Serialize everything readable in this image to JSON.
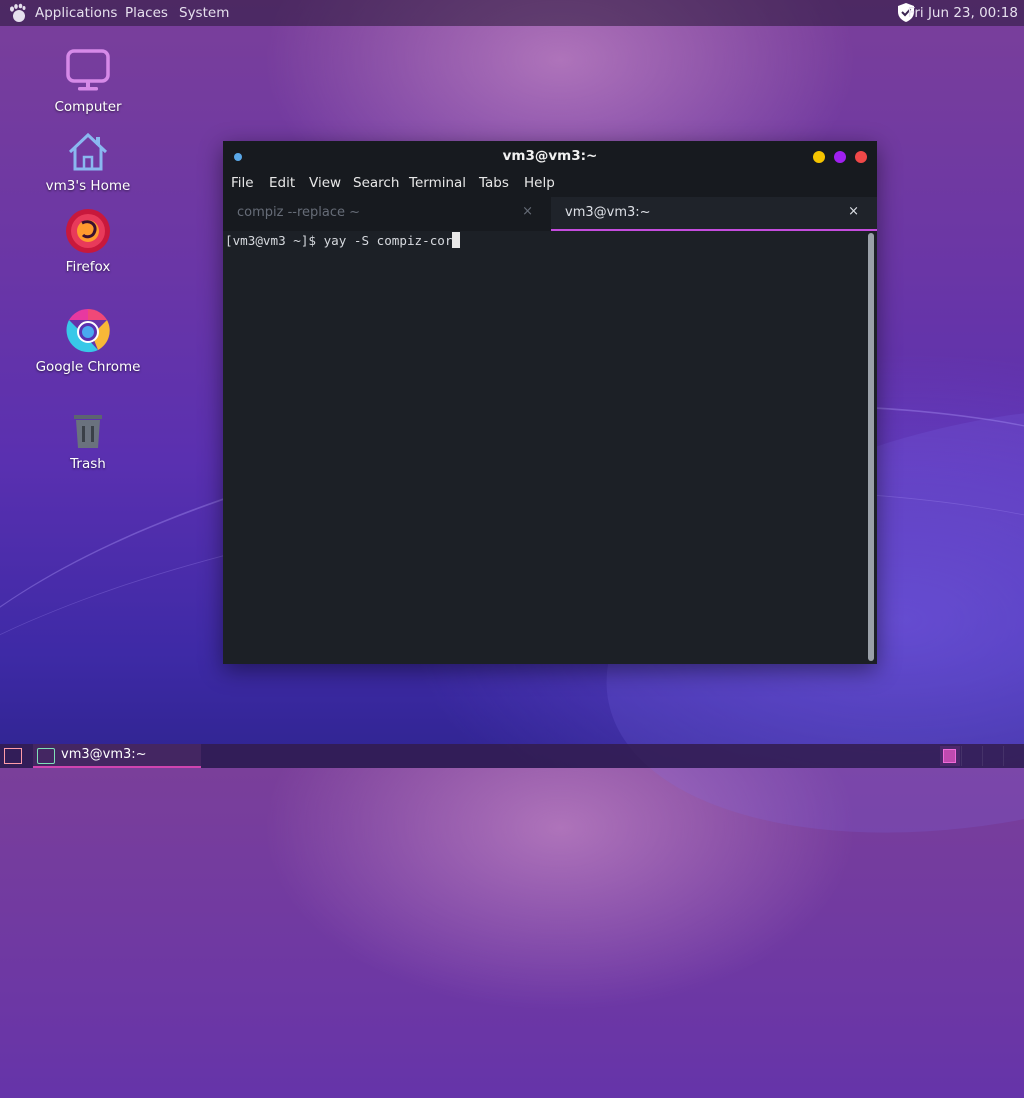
{
  "top_panel": {
    "menus": [
      "Applications",
      "Places",
      "System"
    ],
    "clock": "Fri Jun 23, 00:18"
  },
  "desktop_icons": [
    {
      "label": "Computer",
      "icon": "computer-icon"
    },
    {
      "label": "vm3's Home",
      "icon": "home-folder-icon"
    },
    {
      "label": "Firefox",
      "icon": "firefox-icon"
    },
    {
      "label": "Google Chrome",
      "icon": "chrome-icon"
    },
    {
      "label": "Trash",
      "icon": "trash-icon"
    }
  ],
  "terminal": {
    "title": "vm3@vm3:~",
    "menu": [
      "File",
      "Edit",
      "View",
      "Search",
      "Terminal",
      "Tabs",
      "Help"
    ],
    "tabs": [
      {
        "label": "compiz --replace ~",
        "close": "×",
        "active": false
      },
      {
        "label": "vm3@vm3:~",
        "close": "×",
        "active": true
      }
    ],
    "prompt": "[vm3@vm3 ~]$ yay -S compiz-cor",
    "window_button_colors": [
      "#f5c400",
      "#a020f0",
      "#f04848"
    ]
  },
  "taskbar": {
    "task_label": "vm3@vm3:~"
  },
  "colors": {
    "accent": "#c44cdd",
    "terminal_bg": "#1c2026"
  }
}
